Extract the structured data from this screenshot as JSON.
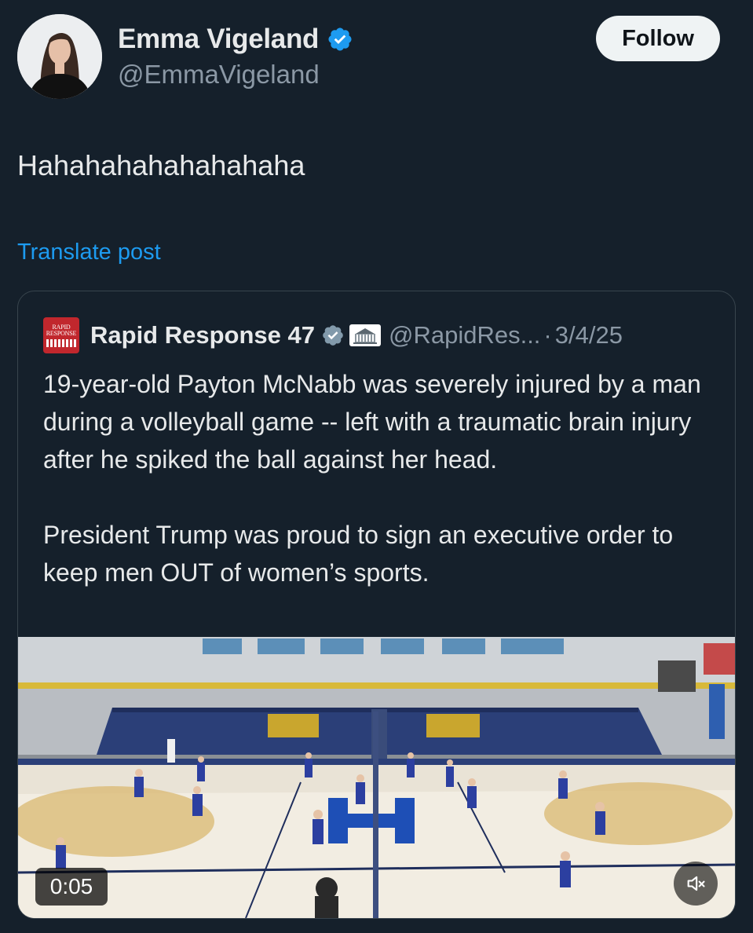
{
  "post": {
    "author_name": "Emma Vigeland",
    "author_handle": "@EmmaVigeland",
    "follow_label": "Follow",
    "text": "Hahahahahahahahaha",
    "translate_label": "Translate post"
  },
  "quoted": {
    "logo_text_line1": "RAPID",
    "logo_text_line2": "RESPONSE",
    "author_name": "Rapid Response 47",
    "author_handle": "@RapidRes...",
    "separator": "·",
    "date": "3/4/25",
    "paragraph1": "19-year-old Payton McNabb was severely injured by a man during a volleyball game -- left with a traumatic brain injury after he spiked the ball against her head.",
    "paragraph2": "President Trump was proud to sign an executive order to keep men OUT of women’s sports.",
    "video_time": "0:05"
  },
  "colors": {
    "background": "#15202b",
    "primary_text": "#e7e9ea",
    "secondary_text": "#8b98a5",
    "link": "#1d9bf0",
    "verified_badge": "#1d9bf0",
    "quote_border": "#38444d"
  },
  "icons": {
    "author_badge": "verified-badge-icon",
    "quoted_badge": "verified-badge-gray-icon",
    "affiliation": "white-house-icon",
    "mute": "speaker-muted-icon"
  }
}
